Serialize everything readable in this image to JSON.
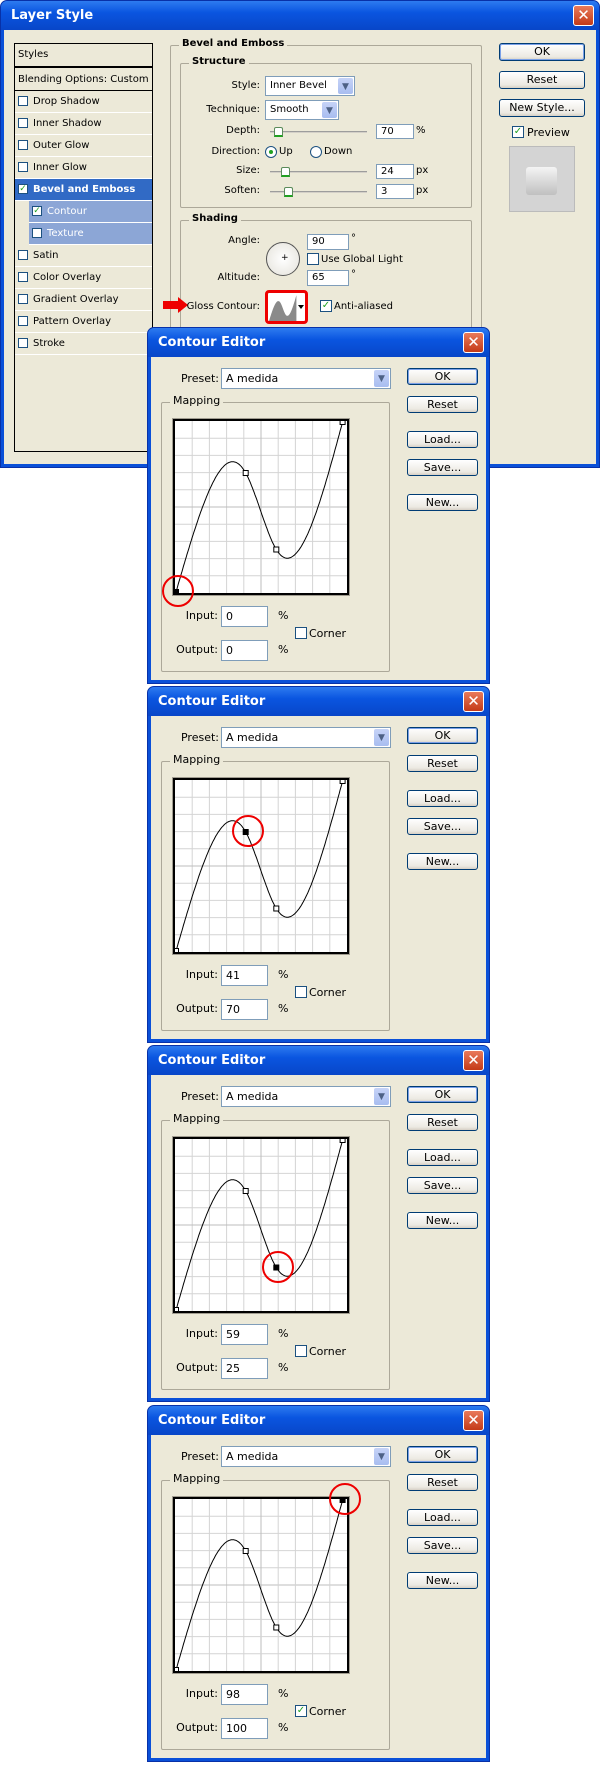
{
  "layer_style": {
    "title": "Layer Style",
    "sidebar": {
      "header": "Styles",
      "blending": "Blending Options: Custom",
      "items": [
        {
          "label": "Drop Shadow",
          "checked": false,
          "selected": false,
          "sub": false
        },
        {
          "label": "Inner Shadow",
          "checked": false,
          "selected": false,
          "sub": false
        },
        {
          "label": "Outer Glow",
          "checked": false,
          "selected": false,
          "sub": false
        },
        {
          "label": "Inner Glow",
          "checked": false,
          "selected": false,
          "sub": false
        },
        {
          "label": "Bevel and Emboss",
          "checked": true,
          "selected": true,
          "sub": false
        },
        {
          "label": "Contour",
          "checked": true,
          "selected": true,
          "sub": true
        },
        {
          "label": "Texture",
          "checked": false,
          "selected": true,
          "sub": true
        },
        {
          "label": "Satin",
          "checked": false,
          "selected": false,
          "sub": false
        },
        {
          "label": "Color Overlay",
          "checked": false,
          "selected": false,
          "sub": false
        },
        {
          "label": "Gradient Overlay",
          "checked": false,
          "selected": false,
          "sub": false
        },
        {
          "label": "Pattern Overlay",
          "checked": false,
          "selected": false,
          "sub": false
        },
        {
          "label": "Stroke",
          "checked": false,
          "selected": false,
          "sub": false
        }
      ]
    },
    "bevel": {
      "group_title": "Bevel and Emboss",
      "structure_title": "Structure",
      "style_label": "Style:",
      "style_value": "Inner Bevel",
      "technique_label": "Technique:",
      "technique_value": "Smooth",
      "depth_label": "Depth:",
      "depth_value": "70",
      "depth_unit": "%",
      "direction_label": "Direction:",
      "dir_up": "Up",
      "dir_down": "Down",
      "direction_selected": "Up",
      "size_label": "Size:",
      "size_value": "24",
      "size_unit": "px",
      "soften_label": "Soften:",
      "soften_value": "3",
      "soften_unit": "px",
      "shading_title": "Shading",
      "angle_label": "Angle:",
      "angle_value": "90",
      "degree": "°",
      "global_light_label": "Use Global Light",
      "global_light_checked": false,
      "altitude_label": "Altitude:",
      "altitude_value": "65",
      "gloss_label": "Gloss Contour:",
      "antialias_label": "Anti-aliased",
      "antialias_checked": true
    },
    "buttons": {
      "ok": "OK",
      "reset": "Reset",
      "new_style": "New Style..."
    },
    "preview_label": "Preview",
    "preview_checked": true
  },
  "contour_editors": [
    {
      "title": "Contour Editor",
      "preset_label": "Preset:",
      "preset_value": "A medida",
      "mapping_label": "Mapping",
      "input_label": "Input:",
      "input_value": "0",
      "output_label": "Output:",
      "output_value": "0",
      "percent": "%",
      "corner_label": "Corner",
      "corner_checked": false,
      "selected_point": 0,
      "buttons": {
        "ok": "OK",
        "reset": "Reset",
        "load": "Load...",
        "save": "Save...",
        "new": "New..."
      }
    },
    {
      "title": "Contour Editor",
      "preset_label": "Preset:",
      "preset_value": "A medida",
      "mapping_label": "Mapping",
      "input_label": "Input:",
      "input_value": "41",
      "output_label": "Output:",
      "output_value": "70",
      "percent": "%",
      "corner_label": "Corner",
      "corner_checked": false,
      "selected_point": 1,
      "buttons": {
        "ok": "OK",
        "reset": "Reset",
        "load": "Load...",
        "save": "Save...",
        "new": "New..."
      }
    },
    {
      "title": "Contour Editor",
      "preset_label": "Preset:",
      "preset_value": "A medida",
      "mapping_label": "Mapping",
      "input_label": "Input:",
      "input_value": "59",
      "output_label": "Output:",
      "output_value": "25",
      "percent": "%",
      "corner_label": "Corner",
      "corner_checked": false,
      "selected_point": 2,
      "buttons": {
        "ok": "OK",
        "reset": "Reset",
        "load": "Load...",
        "save": "Save...",
        "new": "New..."
      }
    },
    {
      "title": "Contour Editor",
      "preset_label": "Preset:",
      "preset_value": "A medida",
      "mapping_label": "Mapping",
      "input_label": "Input:",
      "input_value": "98",
      "output_label": "Output:",
      "output_value": "100",
      "percent": "%",
      "corner_label": "Corner",
      "corner_checked": true,
      "selected_point": 3,
      "buttons": {
        "ok": "OK",
        "reset": "Reset",
        "load": "Load...",
        "save": "Save...",
        "new": "New..."
      }
    }
  ],
  "curve_points": [
    [
      0,
      0
    ],
    [
      41,
      70
    ],
    [
      59,
      25
    ],
    [
      98,
      100
    ]
  ],
  "colors": {
    "titlebar": "#0a55e0",
    "selection": "#316ac5",
    "sub_selection": "#8ca6d6",
    "highlight": "#e00000",
    "dialog_bg": "#ece9d8"
  }
}
